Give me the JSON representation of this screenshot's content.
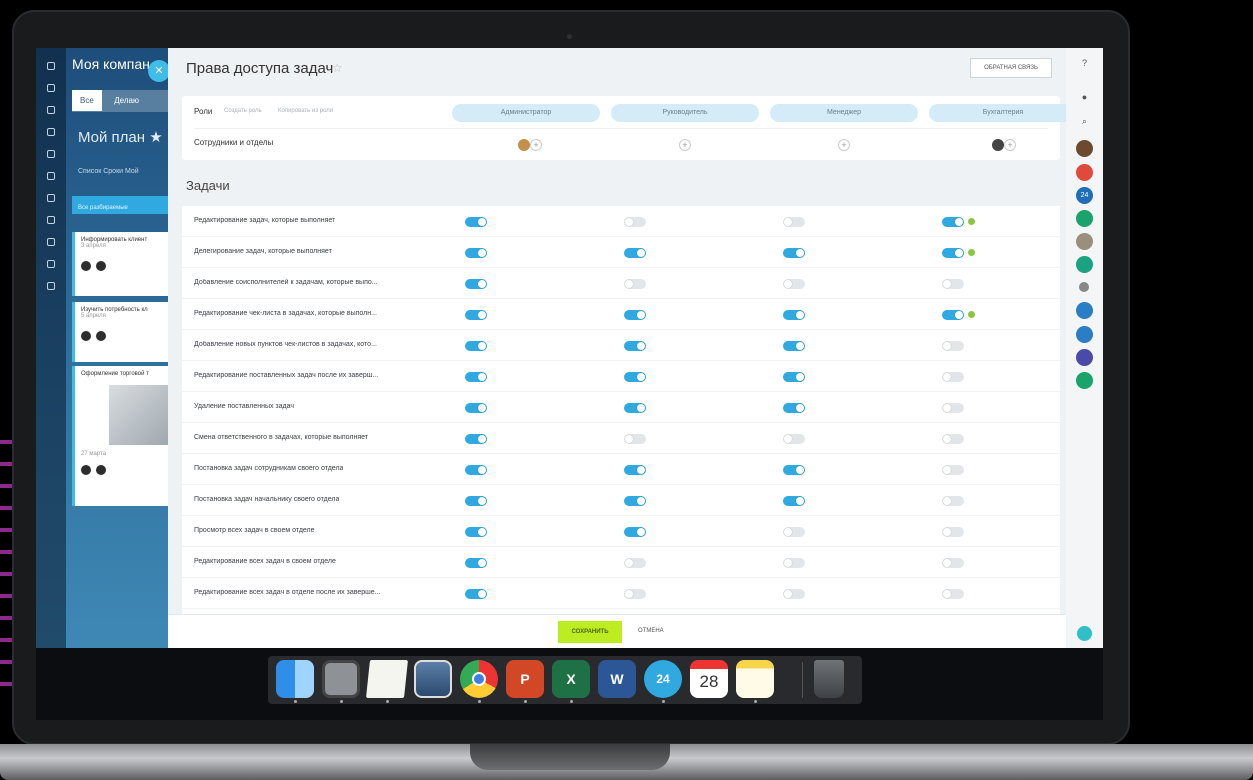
{
  "background_app": {
    "company": "Моя компан",
    "tabs": [
      "Все",
      "Делаю"
    ],
    "plan_title": "Мой план ★",
    "subnav": "Список  Сроки  Мой",
    "filter_label": "Все разбираемые",
    "cards": [
      {
        "title": "Информировать клиент",
        "meta": "3 апреля"
      },
      {
        "title": "Изучить потребность кл",
        "meta": "5 апреля"
      },
      {
        "title": "Оформление торговой т",
        "meta": "27 марта"
      }
    ]
  },
  "panel": {
    "title": "Права доступа задач",
    "feedback_label": "ОБРАТНАЯ СВЯЗЬ",
    "roles_label": "Роли",
    "create_role_link": "Создать роль",
    "copy_role_link": "Копировать из роли",
    "roles": [
      "Администратор",
      "Руководитель",
      "Менеджер",
      "Бухгалтерия"
    ],
    "staff_label": "Сотрудники и отделы",
    "section_title": "Задачи",
    "permissions": [
      {
        "label": "Редактирование задач, которые выполняет",
        "values": [
          true,
          false,
          false,
          true
        ],
        "check": [
          false,
          false,
          false,
          true
        ]
      },
      {
        "label": "Делегирование задач, которые выполняет",
        "values": [
          true,
          true,
          true,
          true
        ],
        "check": [
          false,
          false,
          false,
          true
        ]
      },
      {
        "label": "Добавление соисполнителей к задачам, которые выпо...",
        "values": [
          true,
          false,
          false,
          false
        ],
        "check": [
          false,
          false,
          false,
          false
        ]
      },
      {
        "label": "Редактирование чек-листа в задачах, которые выполн...",
        "values": [
          true,
          true,
          true,
          true
        ],
        "check": [
          false,
          false,
          false,
          true
        ]
      },
      {
        "label": "Добавление новых пунктов чек-листов в задачах, кото...",
        "values": [
          true,
          true,
          true,
          false
        ],
        "check": [
          false,
          false,
          false,
          false
        ]
      },
      {
        "label": "Редактирование поставленных задач после их заверш...",
        "values": [
          true,
          true,
          true,
          false
        ],
        "check": [
          false,
          false,
          false,
          false
        ]
      },
      {
        "label": "Удаление поставленных задач",
        "values": [
          true,
          true,
          true,
          false
        ],
        "check": [
          false,
          false,
          false,
          false
        ]
      },
      {
        "label": "Смена ответственного в задачах, которые выполняет",
        "values": [
          true,
          false,
          false,
          false
        ],
        "check": [
          false,
          false,
          false,
          false
        ]
      },
      {
        "label": "Постановка задач сотрудникам своего отдела",
        "values": [
          true,
          true,
          true,
          false
        ],
        "check": [
          false,
          false,
          false,
          false
        ]
      },
      {
        "label": "Постановка задач начальнику своего отдела",
        "values": [
          true,
          true,
          true,
          false
        ],
        "check": [
          false,
          false,
          false,
          false
        ]
      },
      {
        "label": "Просмотр всех задач в своем отделе",
        "values": [
          true,
          true,
          false,
          false
        ],
        "check": [
          false,
          false,
          false,
          false
        ]
      },
      {
        "label": "Редактирование всех задач в своем отделе",
        "values": [
          true,
          false,
          false,
          false
        ],
        "check": [
          false,
          false,
          false,
          false
        ]
      },
      {
        "label": "Редактирование всех задач в отделе после их заверше...",
        "values": [
          true,
          false,
          false,
          false
        ],
        "check": [
          false,
          false,
          false,
          false
        ]
      }
    ],
    "save_label": "СОХРАНИТЬ",
    "cancel_label": "ОТМЕНА"
  },
  "dock": {
    "apps": [
      "finder-icon",
      "system-preferences-icon",
      "textedit-icon",
      "preview-icon",
      "chrome-icon",
      "powerpoint-icon",
      "excel-icon",
      "word-icon",
      "bitrix24-icon",
      "calendar-icon",
      "notes-icon",
      "trash-icon"
    ],
    "calendar_day": "28",
    "bitrix_label": "24"
  },
  "colors": {
    "toggle_on": "#2fa9e0",
    "save_button": "#bbed21",
    "role_pill": "#d3ecf7"
  }
}
